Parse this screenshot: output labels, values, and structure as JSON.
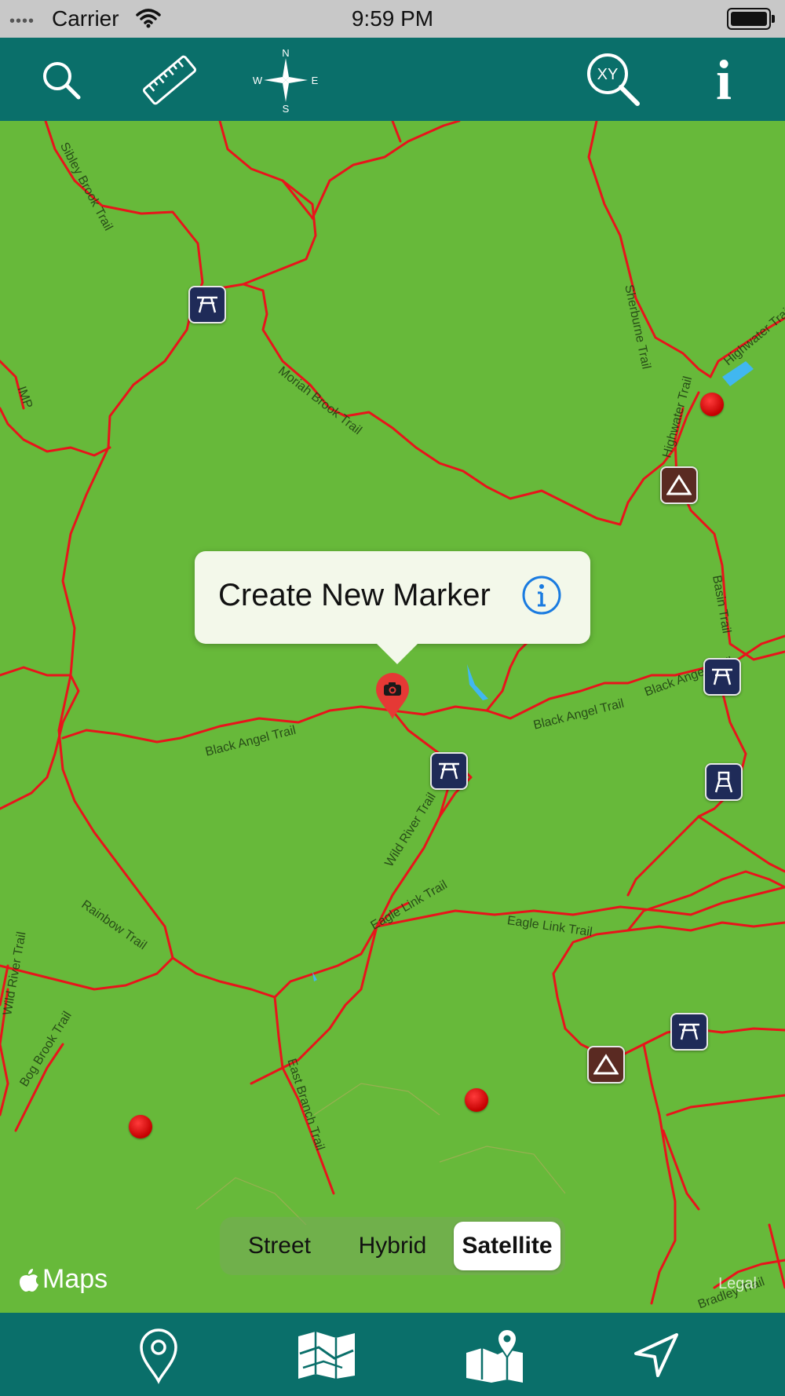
{
  "status_bar": {
    "carrier": "Carrier",
    "time": "9:59 PM",
    "icons": [
      "signal-dots-icon",
      "wifi-icon",
      "battery-icon"
    ]
  },
  "toolbar": {
    "buttons": [
      "search-icon",
      "ruler-icon",
      "compass-rose-icon",
      "xy-coordinate-search-icon",
      "info-icon"
    ],
    "compass_letters": {
      "n": "N",
      "s": "S",
      "e": "E",
      "w": "W"
    },
    "xy_text": "XY",
    "info_text": "i"
  },
  "map": {
    "trail_labels": [
      "Sibley Brook Trail",
      "Sherburne Trail",
      "Highwater Trail",
      "Moriah Brook Trail",
      "IMP",
      "Highwater Trail",
      "Basin Trail",
      "Black Angel Trail",
      "Black Angel Trail",
      "Black Angel Trail",
      "Wild River Trail",
      "Rainbow Trail",
      "Eagle Link Trail",
      "Eagle Link Trail",
      "Wild River Trail",
      "Bog Brook Trail",
      "East Branch Trail",
      "Bradley Trail"
    ],
    "poi_icons": [
      "picnic-area-icon",
      "campground-icon",
      "lookout-tower-icon",
      "red-dot-marker"
    ]
  },
  "callout": {
    "title": "Create New Marker",
    "info_icon": "info-circle-icon"
  },
  "pin": {
    "icon": "camera-pin-icon"
  },
  "map_type": {
    "options": [
      "Street",
      "Hybrid",
      "Satellite"
    ],
    "selected": "Satellite"
  },
  "attribution": {
    "maps": "Maps",
    "legal": "Legal"
  },
  "tab_bar": {
    "tabs": [
      "location-pin-icon",
      "folded-map-icon",
      "map-location-icon",
      "navigation-arrow-icon"
    ]
  },
  "colors": {
    "bar_teal": "#0a6f6a",
    "map_green": "#67b93a",
    "trail_red": "#e8141b",
    "callout_blue": "#1a7be0"
  }
}
